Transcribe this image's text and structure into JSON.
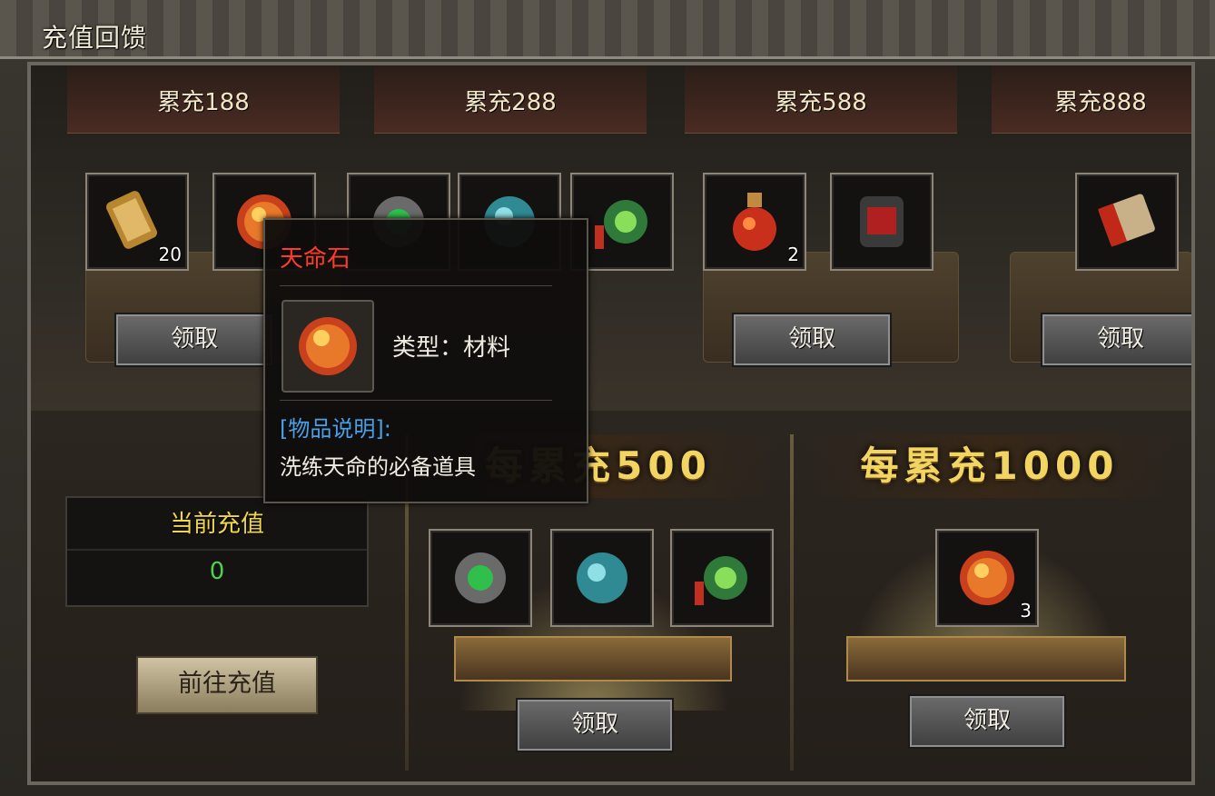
{
  "window": {
    "title": "充值回馈"
  },
  "tiers": [
    {
      "title": "累充188",
      "claim_label": "领取",
      "items": [
        {
          "icon": "scroll-icon",
          "qty": "20"
        },
        {
          "icon": "destiny-stone-icon",
          "qty": ""
        }
      ]
    },
    {
      "title": "累充288",
      "claim_label": "领取",
      "items": [
        {
          "icon": "green-gem-icon",
          "qty": ""
        },
        {
          "icon": "teal-orb-icon",
          "qty": ""
        },
        {
          "icon": "green-amulet-icon",
          "qty": ""
        }
      ]
    },
    {
      "title": "累充588",
      "claim_label": "领取",
      "items": [
        {
          "icon": "red-potion-icon",
          "qty": "2"
        },
        {
          "icon": "red-armor-icon",
          "qty": ""
        }
      ]
    },
    {
      "title": "累充888",
      "claim_label": "领取",
      "items": [
        {
          "icon": "red-scroll-icon",
          "qty": ""
        }
      ]
    }
  ],
  "current_recharge": {
    "label": "当前充值",
    "value": "0"
  },
  "goto_button": {
    "label": "前往充值"
  },
  "every_500": {
    "title": "每累充500",
    "claim_label": "领取",
    "items": [
      {
        "icon": "green-gem-icon",
        "qty": ""
      },
      {
        "icon": "teal-orb-icon",
        "qty": ""
      },
      {
        "icon": "green-amulet-icon",
        "qty": ""
      }
    ]
  },
  "every_1000": {
    "title": "每累充1000",
    "claim_label": "领取",
    "items": [
      {
        "icon": "destiny-stone-icon",
        "qty": "3"
      }
    ]
  },
  "tooltip": {
    "name": "天命石",
    "type_line": "类型：材料",
    "desc_header": "[物品说明]:",
    "desc": "洗练天命的必备道具",
    "icon": "destiny-stone-icon"
  },
  "colors": {
    "accent_gold": "#f1d462",
    "value_green": "#4ed24e",
    "tooltip_name_red": "#ff3a2a",
    "desc_blue": "#4aa0e8"
  }
}
